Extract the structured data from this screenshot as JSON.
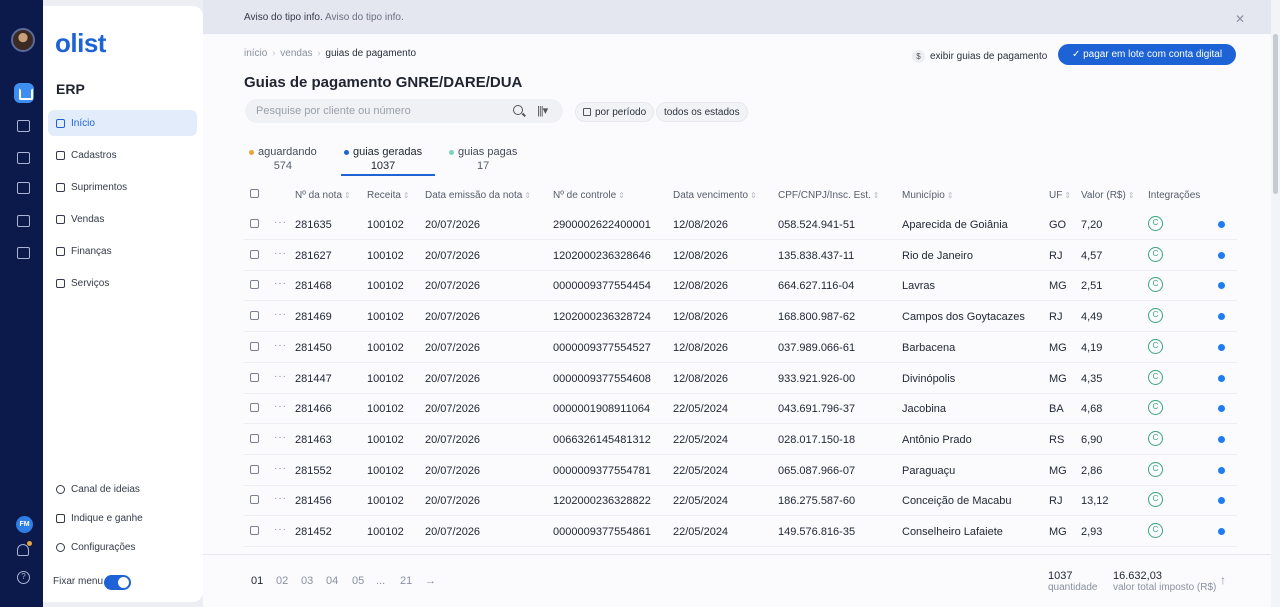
{
  "notice": {
    "title": "Aviso do tipo info.",
    "subtitle": "Aviso do tipo info."
  },
  "sidebar": {
    "brand": "olist",
    "section": "ERP",
    "items": [
      {
        "label": "Início",
        "icon": "home-icon"
      },
      {
        "label": "Cadastros",
        "icon": "file-icon"
      },
      {
        "label": "Suprimentos",
        "icon": "box-icon"
      },
      {
        "label": "Vendas",
        "icon": "cart-icon"
      },
      {
        "label": "Finanças",
        "icon": "money-icon"
      },
      {
        "label": "Serviços",
        "icon": "briefcase-icon"
      }
    ],
    "bottom_items": [
      {
        "label": "Canal de ideias",
        "icon": "lightbulb-icon"
      },
      {
        "label": "Indique e ganhe",
        "icon": "trophy-icon"
      },
      {
        "label": "Configurações",
        "icon": "gear-icon"
      }
    ],
    "fixar_menu": "Fixar menu",
    "user_initials": "FM"
  },
  "breadcrumb": {
    "items": [
      "início",
      "vendas"
    ],
    "current": "guias de pagamento"
  },
  "page_title": "Guias de pagamento GNRE/DARE/DUA",
  "actions": {
    "exibir": "exibir guias de pagamento",
    "pagar": "✓ pagar em lote com conta digital"
  },
  "search": {
    "placeholder": "Pesquise por cliente ou número",
    "value": ""
  },
  "filters": {
    "period": "por período",
    "states": "todos os estados"
  },
  "tabs": [
    {
      "label": "aguardando",
      "count": "574",
      "dot": "#e8a33d"
    },
    {
      "label": "guias geradas",
      "count": "1037",
      "dot": "#1e63d6"
    },
    {
      "label": "guias pagas",
      "count": "17",
      "dot": "#7fd1c1"
    }
  ],
  "table": {
    "headers": [
      "Nº da nota",
      "Receita",
      "Data emissão da nota",
      "Nº de controle",
      "Data vencimento",
      "CPF/CNPJ/Insc. Est.",
      "Município",
      "UF",
      "Valor (R$)",
      "Integrações"
    ],
    "rows": [
      [
        "281635",
        "100102",
        "20/07/2026",
        "2900002622400001",
        "12/08/2026",
        "058.524.941-51",
        "Aparecida de Goiânia",
        "GO",
        "7,20"
      ],
      [
        "281627",
        "100102",
        "20/07/2026",
        "1202000236328646",
        "12/08/2026",
        "135.838.437-11",
        "Rio de Janeiro",
        "RJ",
        "4,57"
      ],
      [
        "281468",
        "100102",
        "20/07/2026",
        "0000009377554454",
        "12/08/2026",
        "664.627.116-04",
        "Lavras",
        "MG",
        "2,51"
      ],
      [
        "281469",
        "100102",
        "20/07/2026",
        "1202000236328724",
        "12/08/2026",
        "168.800.987-62",
        "Campos dos Goytacazes",
        "RJ",
        "4,49"
      ],
      [
        "281450",
        "100102",
        "20/07/2026",
        "0000009377554527",
        "12/08/2026",
        "037.989.066-61",
        "Barbacena",
        "MG",
        "4,19"
      ],
      [
        "281447",
        "100102",
        "20/07/2026",
        "0000009377554608",
        "12/08/2026",
        "933.921.926-00",
        "Divinópolis",
        "MG",
        "4,35"
      ],
      [
        "281466",
        "100102",
        "20/07/2026",
        "0000001908911064",
        "22/05/2024",
        "043.691.796-37",
        "Jacobina",
        "BA",
        "4,68"
      ],
      [
        "281463",
        "100102",
        "20/07/2026",
        "0066326145481312",
        "22/05/2024",
        "028.017.150-18",
        "Antônio Prado",
        "RS",
        "6,90"
      ],
      [
        "281552",
        "100102",
        "20/07/2026",
        "0000009377554781",
        "22/05/2024",
        "065.087.966-07",
        "Paraguaçu",
        "MG",
        "2,86"
      ],
      [
        "281456",
        "100102",
        "20/07/2026",
        "1202000236328822",
        "22/05/2024",
        "186.275.587-60",
        "Conceição de Macabu",
        "RJ",
        "13,12"
      ],
      [
        "281452",
        "100102",
        "20/07/2026",
        "0000009377554861",
        "22/05/2024",
        "149.576.816-35",
        "Conselheiro Lafaiete",
        "MG",
        "2,93"
      ]
    ]
  },
  "pagination": {
    "pages": [
      "01",
      "02",
      "03",
      "04",
      "05",
      "...",
      "21",
      "→"
    ]
  },
  "summary": {
    "quantidade": "1037",
    "quantidade_label": "quantidade",
    "total": "16.632,03",
    "total_label": "valor total imposto (R$)"
  }
}
